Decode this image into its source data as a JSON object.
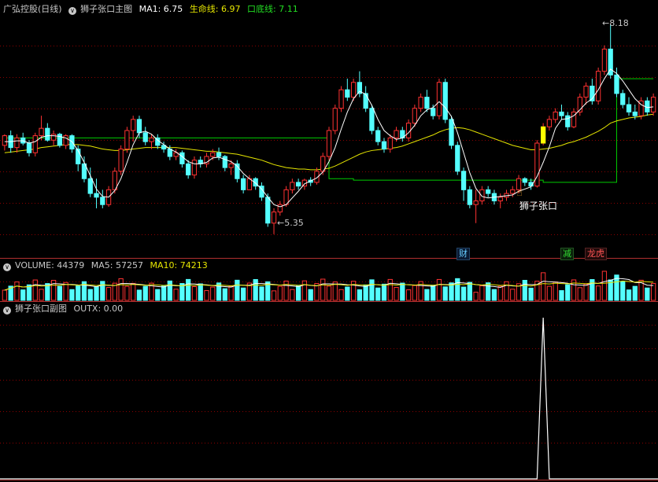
{
  "main_header": {
    "stock": "广弘控股(日线)",
    "indicator": "狮子张口主图",
    "ma1": "MA1: 6.75",
    "life": "生命线: 6.97",
    "bottom": "口底线: 7.11"
  },
  "vol_header": {
    "volume": "VOLUME: 44379",
    "ma5": "MA5: 57257",
    "ma10": "MA10: 74213"
  },
  "sub_header": {
    "indicator": "狮子张口副图",
    "outx": "OUTX: 0.00"
  },
  "annotations": {
    "high": "8.18",
    "low": "5.35",
    "signal": "狮子张口"
  },
  "badges": {
    "cai": "财",
    "jian": "减",
    "longhu": "龙虎"
  },
  "colors": {
    "up": "#ff3232",
    "down": "#54ffff",
    "ma1": "#ffffff",
    "life": "#e6e600",
    "bottom": "#00cc00",
    "signal": "#ffff00",
    "grid": "#8b0000"
  },
  "chart_data": [
    {
      "type": "candlestick",
      "title": "狮子张口主图",
      "ylim": [
        5.2,
        8.3
      ],
      "high_mark": 8.18,
      "low_mark": 5.35,
      "ohlc": [
        [
          6.55,
          6.7,
          6.48,
          6.68
        ],
        [
          6.68,
          6.75,
          6.45,
          6.52
        ],
        [
          6.52,
          6.7,
          6.45,
          6.65
        ],
        [
          6.65,
          6.72,
          6.55,
          6.58
        ],
        [
          6.58,
          6.62,
          6.4,
          6.45
        ],
        [
          6.45,
          6.72,
          6.4,
          6.68
        ],
        [
          6.68,
          6.95,
          6.62,
          6.78
        ],
        [
          6.78,
          6.85,
          6.6,
          6.62
        ],
        [
          6.62,
          6.75,
          6.55,
          6.7
        ],
        [
          6.7,
          6.72,
          6.52,
          6.55
        ],
        [
          6.55,
          6.7,
          6.5,
          6.68
        ],
        [
          6.68,
          6.7,
          6.45,
          6.5
        ],
        [
          6.5,
          6.55,
          6.2,
          6.3
        ],
        [
          6.3,
          6.4,
          6.05,
          6.1
        ],
        [
          6.1,
          6.25,
          5.85,
          5.9
        ],
        [
          5.9,
          6.1,
          5.7,
          5.85
        ],
        [
          5.85,
          5.95,
          5.7,
          5.75
        ],
        [
          5.75,
          6.0,
          5.72,
          5.95
        ],
        [
          5.95,
          6.25,
          5.9,
          6.2
        ],
        [
          6.2,
          6.55,
          6.15,
          6.5
        ],
        [
          6.5,
          6.8,
          6.45,
          6.75
        ],
        [
          6.75,
          6.95,
          6.6,
          6.9
        ],
        [
          6.9,
          6.95,
          6.65,
          6.72
        ],
        [
          6.72,
          6.8,
          6.55,
          6.6
        ],
        [
          6.6,
          6.7,
          6.5,
          6.65
        ],
        [
          6.65,
          6.7,
          6.5,
          6.55
        ],
        [
          6.55,
          6.6,
          6.45,
          6.5
        ],
        [
          6.5,
          6.55,
          6.35,
          6.4
        ],
        [
          6.4,
          6.5,
          6.35,
          6.45
        ],
        [
          6.45,
          6.48,
          6.25,
          6.3
        ],
        [
          6.3,
          6.35,
          6.1,
          6.15
        ],
        [
          6.15,
          6.4,
          6.1,
          6.35
        ],
        [
          6.35,
          6.4,
          6.25,
          6.3
        ],
        [
          6.3,
          6.45,
          6.25,
          6.4
        ],
        [
          6.4,
          6.5,
          6.35,
          6.45
        ],
        [
          6.45,
          6.52,
          6.35,
          6.4
        ],
        [
          6.4,
          6.42,
          6.2,
          6.25
        ],
        [
          6.25,
          6.35,
          6.15,
          6.3
        ],
        [
          6.3,
          6.35,
          6.05,
          6.1
        ],
        [
          6.1,
          6.15,
          5.9,
          5.95
        ],
        [
          5.95,
          6.15,
          5.95,
          6.1
        ],
        [
          6.1,
          6.12,
          5.95,
          6.0
        ],
        [
          6.0,
          6.05,
          5.8,
          5.85
        ],
        [
          5.85,
          5.9,
          5.45,
          5.5
        ],
        [
          5.5,
          5.7,
          5.35,
          5.65
        ],
        [
          5.65,
          5.8,
          5.6,
          5.75
        ],
        [
          5.75,
          6.0,
          5.72,
          5.95
        ],
        [
          5.95,
          6.1,
          5.9,
          6.05
        ],
        [
          6.05,
          6.1,
          5.95,
          6.0
        ],
        [
          6.0,
          6.1,
          5.95,
          6.08
        ],
        [
          6.08,
          6.12,
          6.0,
          6.05
        ],
        [
          6.05,
          6.25,
          6.02,
          6.2
        ],
        [
          6.2,
          6.45,
          6.15,
          6.4
        ],
        [
          6.4,
          6.8,
          6.35,
          6.75
        ],
        [
          6.75,
          7.1,
          6.7,
          7.05
        ],
        [
          7.05,
          7.35,
          7.0,
          7.3
        ],
        [
          7.3,
          7.45,
          7.15,
          7.2
        ],
        [
          7.2,
          7.45,
          7.15,
          7.4
        ],
        [
          7.4,
          7.55,
          7.2,
          7.25
        ],
        [
          7.25,
          7.35,
          7.0,
          7.05
        ],
        [
          7.05,
          7.1,
          6.7,
          6.75
        ],
        [
          6.75,
          6.8,
          6.55,
          6.6
        ],
        [
          6.6,
          6.65,
          6.45,
          6.5
        ],
        [
          6.5,
          6.7,
          6.45,
          6.65
        ],
        [
          6.65,
          6.8,
          6.6,
          6.75
        ],
        [
          6.75,
          6.8,
          6.6,
          6.65
        ],
        [
          6.65,
          6.9,
          6.6,
          6.85
        ],
        [
          6.85,
          7.1,
          6.8,
          7.05
        ],
        [
          7.05,
          7.25,
          7.0,
          7.2
        ],
        [
          7.2,
          7.3,
          7.0,
          7.05
        ],
        [
          7.05,
          7.1,
          6.9,
          6.95
        ],
        [
          6.95,
          7.45,
          6.9,
          7.4
        ],
        [
          7.4,
          7.45,
          6.85,
          6.9
        ],
        [
          6.9,
          6.95,
          6.5,
          6.55
        ],
        [
          6.55,
          6.6,
          6.15,
          6.2
        ],
        [
          6.2,
          6.25,
          5.8,
          5.95
        ],
        [
          5.95,
          6.0,
          5.7,
          5.75
        ],
        [
          5.75,
          5.95,
          5.5,
          5.8
        ],
        [
          5.8,
          6.0,
          5.75,
          5.95
        ],
        [
          5.95,
          6.0,
          5.85,
          5.9
        ],
        [
          5.9,
          5.95,
          5.75,
          5.8
        ],
        [
          5.8,
          5.9,
          5.7,
          5.85
        ],
        [
          5.85,
          5.95,
          5.8,
          5.9
        ],
        [
          5.9,
          6.0,
          5.85,
          5.95
        ],
        [
          5.95,
          6.15,
          5.9,
          6.1
        ],
        [
          6.1,
          6.12,
          6.0,
          6.05
        ],
        [
          6.05,
          6.1,
          5.95,
          6.0
        ],
        [
          6.0,
          6.62,
          5.98,
          6.58
        ],
        [
          6.58,
          6.85,
          6.55,
          6.8
        ],
        [
          6.8,
          6.95,
          6.75,
          6.9
        ],
        [
          6.9,
          7.05,
          6.85,
          7.0
        ],
        [
          7.0,
          7.1,
          6.9,
          6.95
        ],
        [
          6.95,
          7.0,
          6.75,
          6.8
        ],
        [
          6.8,
          7.05,
          6.78,
          7.0
        ],
        [
          7.0,
          7.25,
          6.95,
          7.2
        ],
        [
          7.2,
          7.4,
          7.1,
          7.35
        ],
        [
          7.35,
          7.45,
          7.1,
          7.15
        ],
        [
          7.15,
          7.6,
          7.1,
          7.55
        ],
        [
          7.55,
          7.9,
          7.5,
          7.85
        ],
        [
          7.85,
          8.18,
          7.45,
          7.5
        ],
        [
          7.5,
          7.6,
          7.2,
          7.25
        ],
        [
          7.25,
          7.3,
          7.05,
          7.1
        ],
        [
          7.1,
          7.2,
          6.95,
          7.0
        ],
        [
          7.0,
          7.1,
          6.9,
          6.95
        ],
        [
          6.95,
          7.2,
          6.9,
          7.15
        ],
        [
          7.15,
          7.2,
          6.95,
          7.0
        ],
        [
          7.0,
          7.25,
          6.95,
          7.2
        ]
      ],
      "ma1": [
        6.6,
        6.6,
        6.61,
        6.61,
        6.58,
        6.6,
        6.66,
        6.68,
        6.68,
        6.67,
        6.65,
        6.6,
        6.48,
        6.32,
        6.14,
        5.96,
        5.86,
        5.85,
        5.94,
        6.1,
        6.32,
        6.56,
        6.72,
        6.74,
        6.7,
        6.62,
        6.56,
        6.5,
        6.46,
        6.4,
        6.33,
        6.3,
        6.3,
        6.32,
        6.38,
        6.39,
        6.36,
        6.33,
        6.27,
        6.17,
        6.1,
        6.04,
        5.96,
        5.85,
        5.75,
        5.72,
        5.75,
        5.84,
        5.93,
        6.03,
        6.07,
        6.11,
        6.19,
        6.33,
        6.52,
        6.77,
        7.0,
        7.18,
        7.28,
        7.24,
        7.09,
        6.9,
        6.75,
        6.68,
        6.63,
        6.65,
        6.72,
        6.82,
        6.95,
        7.03,
        7.06,
        7.14,
        7.06,
        6.94,
        6.72,
        6.45,
        6.18,
        5.97,
        5.86,
        5.84,
        5.85,
        5.86,
        5.87,
        5.88,
        5.93,
        5.96,
        5.99,
        6.13,
        6.32,
        6.53,
        6.78,
        6.9,
        6.91,
        6.95,
        7.03,
        7.12,
        7.18,
        7.3,
        7.45,
        7.58,
        7.52,
        7.42,
        7.3,
        7.18,
        7.1,
        7.06,
        7.07
      ],
      "life": [
        6.45,
        6.46,
        6.47,
        6.48,
        6.49,
        6.5,
        6.52,
        6.53,
        6.54,
        6.55,
        6.56,
        6.56,
        6.56,
        6.55,
        6.54,
        6.52,
        6.5,
        6.49,
        6.48,
        6.48,
        6.49,
        6.5,
        6.51,
        6.52,
        6.52,
        6.52,
        6.52,
        6.52,
        6.52,
        6.51,
        6.5,
        6.49,
        6.48,
        6.47,
        6.47,
        6.46,
        6.45,
        6.44,
        6.43,
        6.41,
        6.39,
        6.37,
        6.35,
        6.32,
        6.29,
        6.27,
        6.25,
        6.24,
        6.23,
        6.23,
        6.22,
        6.22,
        6.23,
        6.24,
        6.27,
        6.31,
        6.35,
        6.39,
        6.43,
        6.46,
        6.48,
        6.49,
        6.5,
        6.51,
        6.52,
        6.54,
        6.57,
        6.6,
        6.63,
        6.66,
        6.69,
        6.73,
        6.76,
        6.78,
        6.79,
        6.78,
        6.76,
        6.73,
        6.7,
        6.67,
        6.64,
        6.61,
        6.58,
        6.55,
        6.53,
        6.51,
        6.49,
        6.49,
        6.5,
        6.51,
        6.53,
        6.55,
        6.58,
        6.6,
        6.63,
        6.66,
        6.7,
        6.74,
        6.79,
        6.85,
        6.88,
        6.9,
        6.92,
        6.93,
        6.94,
        6.96,
        6.97
      ],
      "bottom_steps": [
        [
          0,
          53,
          6.65
        ],
        [
          53,
          57,
          6.1
        ],
        [
          57,
          88,
          6.08
        ],
        [
          88,
          100,
          6.05
        ],
        [
          100,
          107,
          7.45
        ]
      ]
    },
    {
      "type": "bar",
      "title": "VOLUME",
      "values_relative": "volume bars colored by up/down day; latest 44379, MA5 57257, MA10 74213"
    },
    {
      "type": "line",
      "title": "狮子张口副图",
      "series": [
        {
          "name": "OUTX",
          "spike_index": 88,
          "spike_value": 1
        }
      ]
    }
  ]
}
